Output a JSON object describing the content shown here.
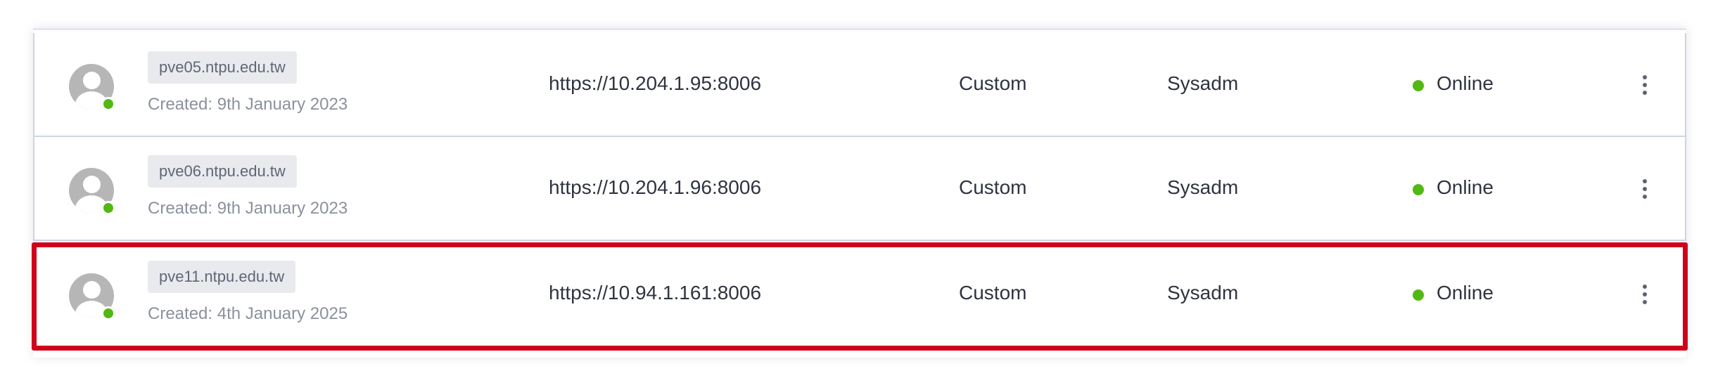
{
  "rows": [
    {
      "host": "pve05.ntpu.edu.tw",
      "created": "Created: 9th January 2023",
      "url": "https://10.204.1.95:8006",
      "type": "Custom",
      "owner": "Sysadm",
      "status": "Online"
    },
    {
      "host": "pve06.ntpu.edu.tw",
      "created": "Created: 9th January 2023",
      "url": "https://10.204.1.96:8006",
      "type": "Custom",
      "owner": "Sysadm",
      "status": "Online"
    },
    {
      "host": "pve11.ntpu.edu.tw",
      "created": "Created: 4th January 2025",
      "url": "https://10.94.1.161:8006",
      "type": "Custom",
      "owner": "Sysadm",
      "status": "Online"
    }
  ],
  "colors": {
    "online": "#52b812",
    "highlight": "#d0021b"
  },
  "icons": {
    "avatar": "user-avatar-icon",
    "menu": "vertical-ellipsis-icon"
  }
}
